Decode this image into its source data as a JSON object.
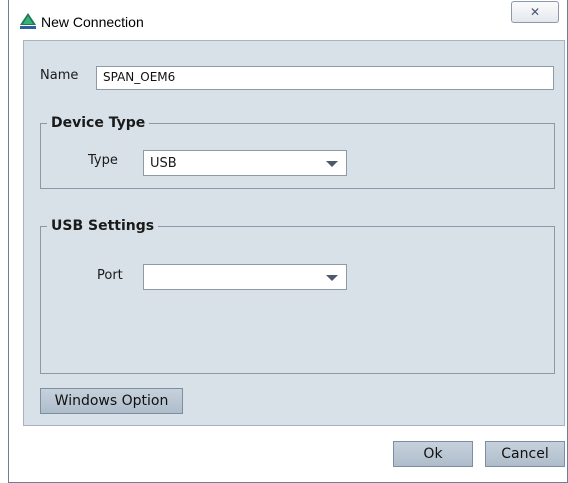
{
  "window": {
    "title": "New Connection",
    "close_glyph": "✕",
    "icon": "navigation-app-icon"
  },
  "form": {
    "name_label": "Name",
    "name_value": "SPAN_OEM6"
  },
  "device_type": {
    "legend": "Device Type",
    "type_label": "Type",
    "type_value": "USB"
  },
  "usb_settings": {
    "legend": "USB Settings",
    "port_label": "Port",
    "port_value": ""
  },
  "buttons": {
    "windows_option": "Windows Option",
    "ok": "Ok",
    "cancel": "Cancel"
  },
  "colors": {
    "panel_background": "#d8e1e8",
    "button_background": "#b8c5d2"
  }
}
